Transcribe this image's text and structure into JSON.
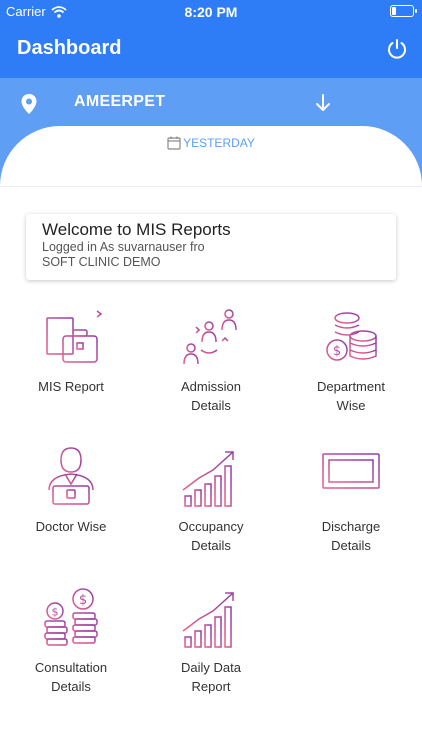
{
  "status_bar": {
    "carrier": "Carrier",
    "time": "8:20 PM"
  },
  "header": {
    "title": "Dashboard",
    "power_icon": "power-icon"
  },
  "location": {
    "name": "AMEERPET",
    "pin_icon": "location-pin-icon",
    "arrow_icon": "arrow-down-icon"
  },
  "date_filter": {
    "label": "YESTERDAY",
    "icon": "calendar-icon"
  },
  "welcome": {
    "title": "Welcome to MIS Reports",
    "line1": "Logged in As suvarnauser fro",
    "line2": "SOFT CLINIC DEMO"
  },
  "tiles": [
    {
      "l1": "MIS Report",
      "l2": "",
      "icon": "briefcase-icon"
    },
    {
      "l1": "Admission",
      "l2": "Details",
      "icon": "admission-people-icon"
    },
    {
      "l1": "Department",
      "l2": "Wise",
      "icon": "coin-stack-icon"
    },
    {
      "l1": "Doctor Wise",
      "l2": "",
      "icon": "doctor-icon"
    },
    {
      "l1": "Occupancy",
      "l2": "Details",
      "icon": "growth-chart-icon"
    },
    {
      "l1": "Discharge",
      "l2": "Details",
      "icon": "billboard-icon"
    },
    {
      "l1": "Consultation",
      "l2": "Details",
      "icon": "coins-icon"
    },
    {
      "l1": "Daily Data",
      "l2": "Report",
      "icon": "growth-chart-icon"
    }
  ],
  "colors": {
    "primary": "#2f7df6",
    "secondary": "#5f9ef5",
    "icon_gradient_start": "#e0558f",
    "icon_gradient_end": "#8a3fa8"
  }
}
